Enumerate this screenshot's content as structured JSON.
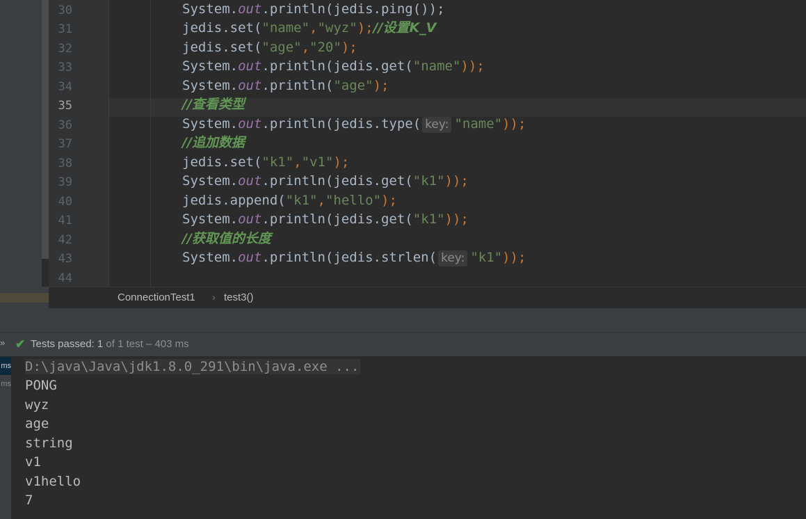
{
  "editor": {
    "lines": [
      {
        "n": "30",
        "tokens": [
          {
            "t": "System."
          },
          {
            "t": "out",
            "k": "f"
          },
          {
            "t": ".println(jedis.ping());"
          }
        ]
      },
      {
        "n": "31",
        "tokens": [
          {
            "t": "jedis.set("
          },
          {
            "t": "\"name\"",
            "k": "s"
          },
          {
            "t": ",",
            "k": "p"
          },
          {
            "t": "\"wyz\"",
            "k": "s"
          },
          {
            "t": ");",
            "k": "p"
          },
          {
            "t": "//设置K_V",
            "k": "c"
          }
        ]
      },
      {
        "n": "32",
        "tokens": [
          {
            "t": "jedis.set("
          },
          {
            "t": "\"age\"",
            "k": "s"
          },
          {
            "t": ",",
            "k": "p"
          },
          {
            "t": "\"20\"",
            "k": "s"
          },
          {
            "t": ");",
            "k": "p"
          }
        ]
      },
      {
        "n": "33",
        "tokens": [
          {
            "t": "System."
          },
          {
            "t": "out",
            "k": "f"
          },
          {
            "t": ".println(jedis.get("
          },
          {
            "t": "\"name\"",
            "k": "s"
          },
          {
            "t": "));",
            "k": "p"
          }
        ]
      },
      {
        "n": "34",
        "tokens": [
          {
            "t": "System."
          },
          {
            "t": "out",
            "k": "f"
          },
          {
            "t": ".println("
          },
          {
            "t": "\"age\"",
            "k": "s"
          },
          {
            "t": ");",
            "k": "p"
          }
        ]
      },
      {
        "n": "35",
        "current": true,
        "tokens": [
          {
            "t": "//查看类型",
            "k": "c"
          }
        ]
      },
      {
        "n": "36",
        "tokens": [
          {
            "t": "System."
          },
          {
            "t": "out",
            "k": "f"
          },
          {
            "t": ".println(jedis.type("
          },
          {
            "t": "key:",
            "k": "hint"
          },
          {
            "t": "\"name\"",
            "k": "s"
          },
          {
            "t": "));",
            "k": "p"
          }
        ]
      },
      {
        "n": "37",
        "tokens": [
          {
            "t": "//追加数据",
            "k": "c"
          }
        ]
      },
      {
        "n": "38",
        "tokens": [
          {
            "t": "jedis.set("
          },
          {
            "t": "\"k1\"",
            "k": "s"
          },
          {
            "t": ",",
            "k": "p"
          },
          {
            "t": "\"v1\"",
            "k": "s"
          },
          {
            "t": ");",
            "k": "p"
          }
        ]
      },
      {
        "n": "39",
        "tokens": [
          {
            "t": "System."
          },
          {
            "t": "out",
            "k": "f"
          },
          {
            "t": ".println(jedis.get("
          },
          {
            "t": "\"k1\"",
            "k": "s"
          },
          {
            "t": "));",
            "k": "p"
          }
        ]
      },
      {
        "n": "40",
        "tokens": [
          {
            "t": "jedis.append("
          },
          {
            "t": "\"k1\"",
            "k": "s"
          },
          {
            "t": ",",
            "k": "p"
          },
          {
            "t": "\"hello\"",
            "k": "s"
          },
          {
            "t": ");",
            "k": "p"
          }
        ]
      },
      {
        "n": "41",
        "tokens": [
          {
            "t": "System."
          },
          {
            "t": "out",
            "k": "f"
          },
          {
            "t": ".println(jedis.get("
          },
          {
            "t": "\"k1\"",
            "k": "s"
          },
          {
            "t": "));",
            "k": "p"
          }
        ]
      },
      {
        "n": "42",
        "tokens": [
          {
            "t": "//获取值的长度",
            "k": "c"
          }
        ]
      },
      {
        "n": "43",
        "tokens": [
          {
            "t": "System."
          },
          {
            "t": "out",
            "k": "f"
          },
          {
            "t": ".println(jedis.strlen("
          },
          {
            "t": "key:",
            "k": "hint"
          },
          {
            "t": "\"k1\"",
            "k": "s"
          },
          {
            "t": "));",
            "k": "p"
          }
        ]
      },
      {
        "n": "44",
        "tokens": []
      }
    ]
  },
  "breadcrumb": {
    "class_name": "ConnectionTest1",
    "separator": "›",
    "method_name": "test3()"
  },
  "run_panel": {
    "more_icon": "»",
    "check_icon": "✔",
    "status_label": "Tests passed: ",
    "status_count": "1",
    "status_detail": " of 1 test – 403 ms",
    "tree_items": [
      "ms",
      "ms"
    ]
  },
  "console": {
    "command": "D:\\java\\Java\\jdk1.8.0_291\\bin\\java.exe ...",
    "output": [
      "PONG",
      "wyz",
      "age",
      "string",
      "v1",
      "v1hello",
      "7"
    ]
  },
  "colors": {
    "background": "#2b2b2b",
    "string": "#6a8759",
    "field": "#9876aa",
    "punct": "#cc7832",
    "comment": "#629755",
    "pass": "#4fa04f"
  }
}
